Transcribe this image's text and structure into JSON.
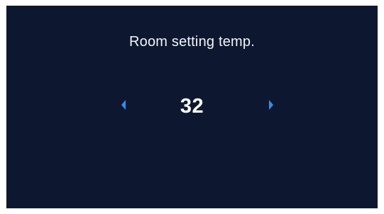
{
  "screen": {
    "title": "Room setting temp.",
    "value": "32"
  },
  "icons": {
    "decrease": "chevron-left-icon",
    "increase": "chevron-right-icon"
  },
  "colors": {
    "background": "#0d1830",
    "text": "#ffffff",
    "accent": "#2e8ff0"
  }
}
